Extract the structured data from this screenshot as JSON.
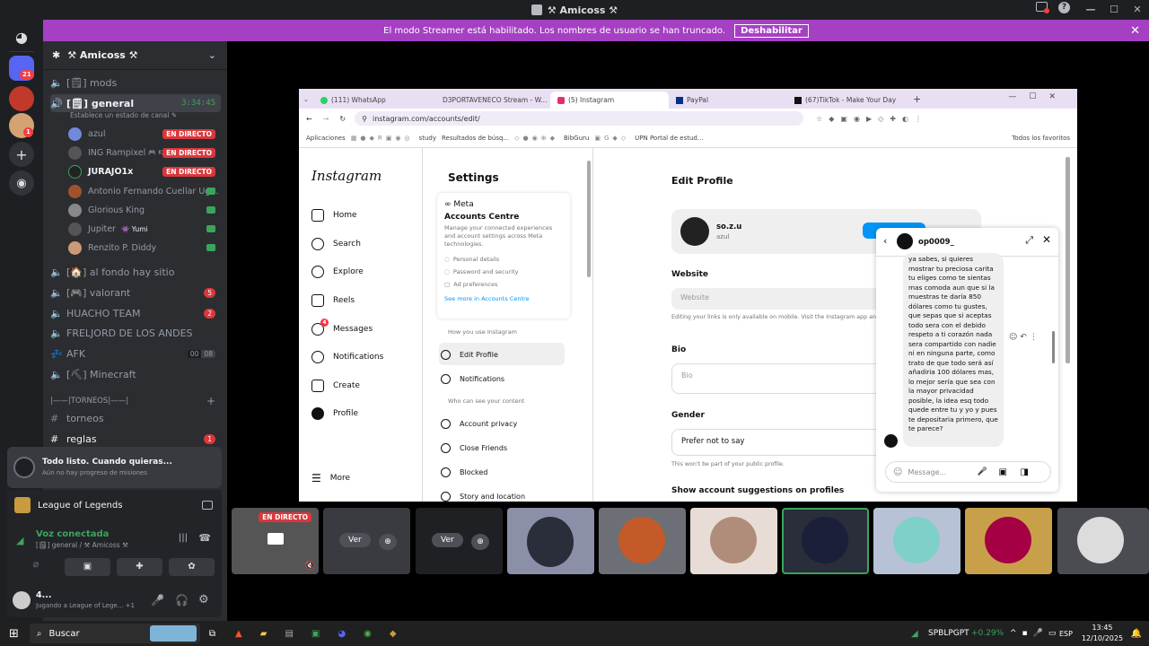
{
  "window": {
    "title": "⚒ Amicoss ⚒",
    "min": "—",
    "max": "☐",
    "close": "✕"
  },
  "banner": {
    "text": "El modo Streamer está habilitado. Los nombres de usuario se han truncado.",
    "button": "Deshabilitar",
    "close": "✕"
  },
  "rail": {
    "badges": [
      "21",
      "1"
    ]
  },
  "server": {
    "name": "⚒ Amicoss ⚒"
  },
  "channels": [
    {
      "name": "[🗒] mods",
      "type": "voice"
    },
    {
      "name": "[🗒] general",
      "type": "voice",
      "time": "3:34:45",
      "status": "Establece un estado de canal ✎"
    }
  ],
  "voice_users": [
    {
      "name": "azul",
      "live": "EN DIRECTO",
      "color": "#7289da"
    },
    {
      "name": "ING Rampixel",
      "extra": "🎮 KA",
      "live": "EN DIRECTO",
      "color": "#555"
    },
    {
      "name": "JURAJO1x",
      "live": "EN DIRECTO",
      "color": "#222"
    },
    {
      "name": "Antonio Fernando Cuellar Ug...",
      "color": "#a0522d"
    },
    {
      "name": "Glorious King",
      "color": "#888"
    },
    {
      "name": "Jupiter",
      "extra": "👾 Yumi",
      "color": "#555"
    },
    {
      "name": "Renzito P. Diddy",
      "color": "#c97"
    }
  ],
  "channels2": [
    {
      "name": "[🏠] al fondo hay sitio"
    },
    {
      "name": "[🎮] valorant",
      "badge": "5"
    },
    {
      "name": "HUACHO TEAM",
      "badge": "2"
    },
    {
      "name": "FRELJORD DE LOS ANDES"
    },
    {
      "name": "AFK",
      "counts": [
        "00",
        "08"
      ]
    },
    {
      "name": "[⛏] Minecraft"
    }
  ],
  "category": "|——|TORNEOS|——|",
  "channels3": [
    {
      "name": "torneos"
    },
    {
      "name": "reglas",
      "badge": "1"
    }
  ],
  "quest": {
    "title": "Todo listo. Cuando quieras...",
    "sub": "Aún no hay progreso de misiones"
  },
  "game": {
    "name": "League of Legends"
  },
  "voice": {
    "status": "Voz conectada",
    "channel": "[🗒] general / ⚒ Amicoss ⚒"
  },
  "user": {
    "name": "4...",
    "activity": "Jugando a League of Lege... +1"
  },
  "browser": {
    "tabs": [
      "(111) WhatsApp",
      "D3PORTAVENECO Stream - W...",
      "(5) Instagram",
      "PayPal",
      "(67)TikTok - Make Your Day"
    ],
    "url": "instagram.com/accounts/edit/",
    "bookmarks": [
      "Aplicaciones",
      "study",
      "Resultados de búsq...",
      "BibGuru",
      "UPN Portal de estud...",
      "Todos los favoritos"
    ]
  },
  "ig": {
    "logo": "Instagram",
    "nav": [
      "Home",
      "Search",
      "Explore",
      "Reels",
      "Messages",
      "Notifications",
      "Create",
      "Profile",
      "More"
    ],
    "msg_badge": "4",
    "settings_title": "Settings",
    "meta": "∞ Meta",
    "accounts_centre": "Accounts Centre",
    "ac_desc": "Manage your connected experiences and account settings across Meta technologies.",
    "ac_items": [
      "Personal details",
      "Password and security",
      "Ad preferences"
    ],
    "ac_link": "See more in Accounts Centre",
    "how_use": "How you use Instagram",
    "edit_profile": "Edit Profile",
    "notifications": "Notifications",
    "who_see": "Who can see your content",
    "privacy_items": [
      "Account privacy",
      "Close Friends",
      "Blocked",
      "Story and location"
    ],
    "edit_title": "Edit Profile",
    "username": "so.z.u",
    "fullname": "azul",
    "website_label": "Website",
    "website_ph": "Website",
    "website_note": "Editing your links is only available on mobile. Visit the Instagram app and edit your bio.",
    "bio_label": "Bio",
    "bio_ph": "Bio",
    "gender_label": "Gender",
    "gender_val": "Prefer not to say",
    "gender_note": "This won't be part of your public profile.",
    "suggest": "Show account suggestions on profiles"
  },
  "dm": {
    "user": "op0009_",
    "message": "ya sabes, si quieres mostrar tu preciosa carita tu eliges como te sientas mas comoda aun que si la muestras te daría 850 dólares como tu gustes, que sepas que si aceptas todo sera con el debido respeto a ti corazón nada sera compartido con nadie ni en ninguna parte, como trato de que todo será así añadiria 100 dólares mas, lo mejor sería que sea con la mayor privacidad posible, la idea esq todo quede entre tu y yo y pues te depositaria primero, que te parece?",
    "input_ph": "Message..."
  },
  "tiles": {
    "live": "EN DIRECTO",
    "ver": "Ver"
  },
  "taskbar": {
    "search": "Buscar",
    "stock": "SPBLPGPT",
    "change": "+0.29%",
    "lang": "ESP",
    "time": "13:45",
    "date": "12/10/2025"
  }
}
